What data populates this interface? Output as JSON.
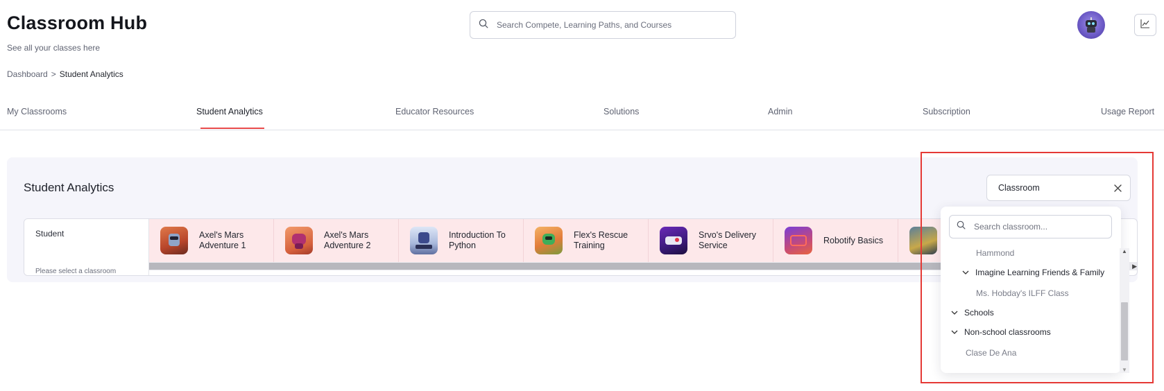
{
  "header": {
    "title": "Classroom Hub",
    "subtitle": "See all your classes here",
    "search_placeholder": "Search Compete, Learning Paths, and Courses",
    "avatar_icon": "robot-avatar",
    "chart_icon": "trend-chart-icon"
  },
  "breadcrumb": {
    "root": "Dashboard",
    "separator": ">",
    "current": "Student Analytics"
  },
  "nav": {
    "tabs": [
      {
        "label": "My Classrooms"
      },
      {
        "label": "Student Analytics"
      },
      {
        "label": "Educator Resources"
      },
      {
        "label": "Solutions"
      },
      {
        "label": "Admin"
      },
      {
        "label": "Subscription"
      },
      {
        "label": "Usage Report"
      }
    ],
    "active_tab": "Student Analytics",
    "accent_color": "#e84a4a"
  },
  "analytics": {
    "title": "Student Analytics",
    "student_header": "Student",
    "empty_message": "Please select a classroom",
    "courses": [
      {
        "label": "Axel's Mars Adventure 1"
      },
      {
        "label": "Axel's Mars Adventure 2"
      },
      {
        "label": "Introduction To Python"
      },
      {
        "label": "Flex's Rescue Training"
      },
      {
        "label": "Srvo's Delivery Service"
      },
      {
        "label": "Robotify Basics"
      },
      {
        "label": ""
      }
    ]
  },
  "classroom_filter": {
    "value": "Classroom",
    "clear_icon": "close-icon",
    "search_placeholder": "Search classroom...",
    "items": [
      {
        "label": "Hammond",
        "type": "leaf"
      },
      {
        "label": "Imagine Learning Friends & Family",
        "type": "group"
      },
      {
        "label": "Ms. Hobday's ILFF Class",
        "type": "leaf"
      },
      {
        "label": "Schools",
        "type": "group"
      },
      {
        "label": "Non-school classrooms",
        "type": "group"
      },
      {
        "label": "Clase De Ana",
        "type": "leaf"
      }
    ]
  },
  "highlight_color": "#e53935"
}
